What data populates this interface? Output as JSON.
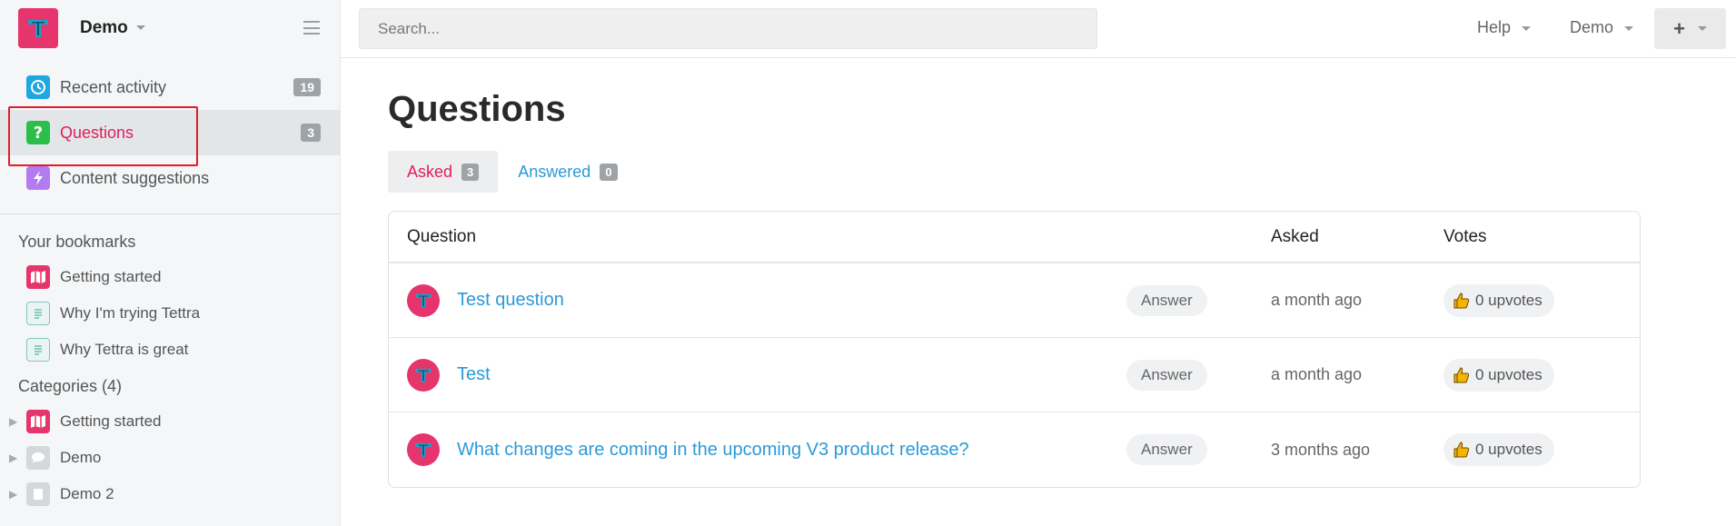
{
  "sidebar": {
    "workspace": "Demo",
    "nav": [
      {
        "label": "Recent activity",
        "count": "19",
        "icon": "clock-icon",
        "color": "#1ea7e1"
      },
      {
        "label": "Questions",
        "count": "3",
        "icon": "question-icon",
        "color": "#2bbf4a"
      },
      {
        "label": "Content suggestions",
        "count": "",
        "icon": "bolt-icon",
        "color": "#b27cf0"
      }
    ],
    "bookmarks_title": "Your bookmarks",
    "bookmarks": [
      {
        "label": "Getting started",
        "icon": "map-icon"
      },
      {
        "label": "Why I'm trying Tettra",
        "icon": "document-icon"
      },
      {
        "label": "Why Tettra is great",
        "icon": "document-icon"
      }
    ],
    "categories_title": "Categories (4)",
    "categories": [
      {
        "label": "Getting started",
        "icon": "map-icon"
      },
      {
        "label": "Demo",
        "icon": "chat-icon"
      },
      {
        "label": "Demo 2",
        "icon": "book-icon"
      }
    ]
  },
  "topbar": {
    "search_placeholder": "Search...",
    "help": "Help",
    "user": "Demo",
    "plus": "+"
  },
  "main": {
    "title": "Questions",
    "tabs": [
      {
        "label": "Asked",
        "count": "3"
      },
      {
        "label": "Answered",
        "count": "0"
      }
    ],
    "columns": [
      "Question",
      "Asked",
      "Votes"
    ],
    "rows": [
      {
        "title": "Test question",
        "action": "Answer",
        "asked": "a month ago",
        "votes": "0 upvotes"
      },
      {
        "title": "Test",
        "action": "Answer",
        "asked": "a month ago",
        "votes": "0 upvotes"
      },
      {
        "title": "What changes are coming in the upcoming V3 product release?",
        "action": "Answer",
        "asked": "3 months ago",
        "votes": "0 upvotes"
      }
    ]
  },
  "colors": {
    "brand": "#e6346c",
    "active_text": "#e21d57",
    "link": "#2b9ad8"
  }
}
